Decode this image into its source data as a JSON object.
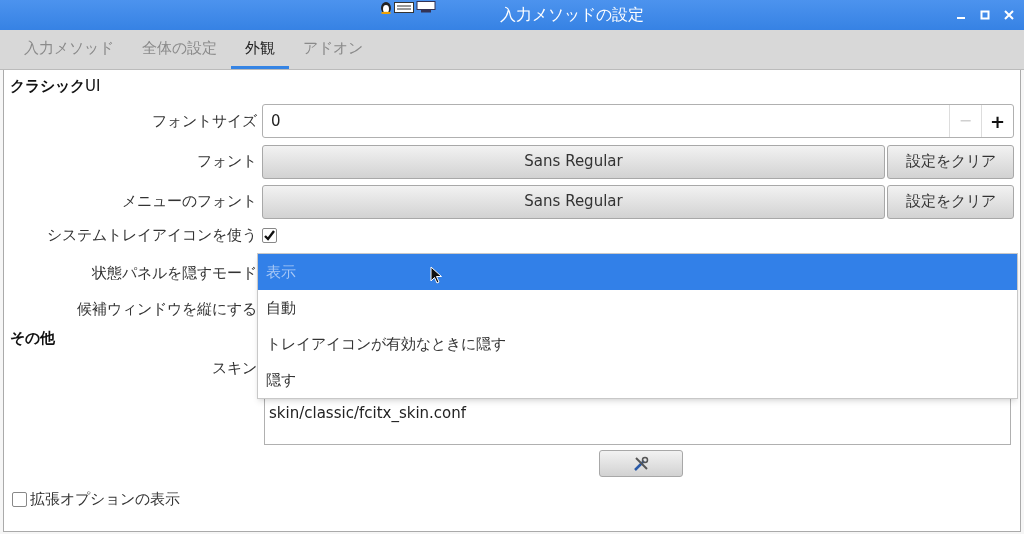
{
  "window": {
    "title": "入力メソッドの設定"
  },
  "tabs": [
    {
      "label": "入力メソッド",
      "selected": false
    },
    {
      "label": "全体の設定",
      "selected": false
    },
    {
      "label": "外観",
      "selected": true
    },
    {
      "label": "アドオン",
      "selected": false
    }
  ],
  "section_classic": {
    "title": "**クラシック**UI"
  },
  "font_size": {
    "label": "フォントサイズ",
    "value": "0",
    "minus": "−",
    "plus": "+",
    "minus_disabled": true
  },
  "font": {
    "label": "フォント",
    "value": "Sans Regular",
    "clear": "設定をクリア"
  },
  "menu_font": {
    "label": "メニューのフォント",
    "value": "Sans Regular",
    "clear": "設定をクリア"
  },
  "tray_icon": {
    "label": "システムトレイアイコンを使う",
    "checked": true
  },
  "hide_panel_mode": {
    "label": "状態パネルを隠すモード",
    "options": [
      {
        "label": "表示",
        "selected": true
      },
      {
        "label": "自動",
        "selected": false
      },
      {
        "label": "トレイアイコンが有効なときに隠す",
        "selected": false
      },
      {
        "label": "隠す",
        "selected": false
      }
    ]
  },
  "vertical_candidates": {
    "label": "候補ウィンドウを縦にする"
  },
  "section_other": {
    "title": "その他"
  },
  "skin": {
    "label": "スキン",
    "items": [
      "skin/classic/fcitx_skin.conf"
    ]
  },
  "advanced_options": {
    "label": "拡張オプションの表示",
    "checked": false
  }
}
